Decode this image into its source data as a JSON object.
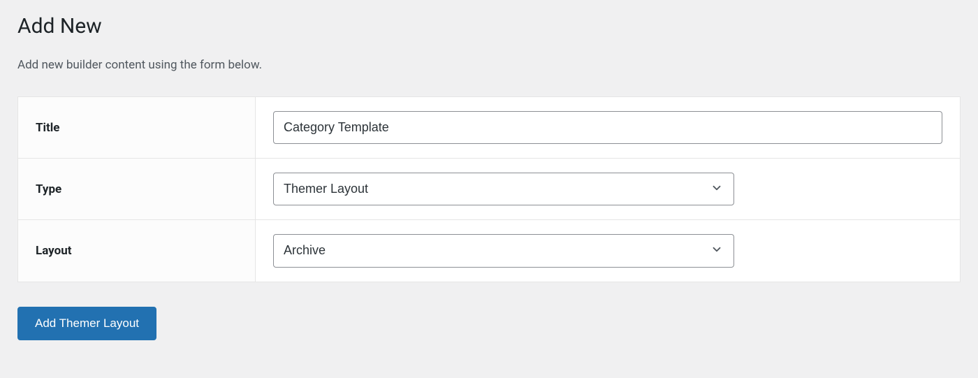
{
  "header": {
    "title": "Add New",
    "description": "Add new builder content using the form below."
  },
  "form": {
    "title_row": {
      "label": "Title",
      "value": "Category Template"
    },
    "type_row": {
      "label": "Type",
      "value": "Themer Layout"
    },
    "layout_row": {
      "label": "Layout",
      "value": "Archive"
    }
  },
  "actions": {
    "submit_label": "Add Themer Layout"
  }
}
